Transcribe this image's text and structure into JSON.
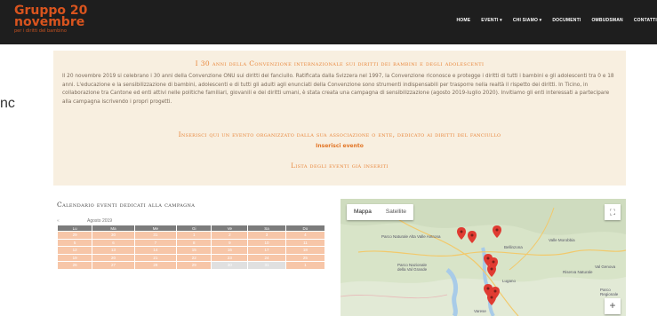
{
  "logo": {
    "line1": "Gruppo 20",
    "line2": "novembre",
    "line3": "per i diritti del bambino"
  },
  "nav": [
    "HOME",
    "EVENTI ▾",
    "CHI SIAMO ▾",
    "DOCUMENTI",
    "OMBUDSMAN",
    "CONTATTI"
  ],
  "stray_text": "nc",
  "banner": {
    "title": "I 30 anni della Convenzione internazionale sui diritti dei bambini e degli adolescenti",
    "body": "Il 20 novembre 2019 si celebrano i 30 anni della Convenzione ONU sui diritti del fanciullo. Ratificata dalla Svizzera nel 1997, la Convenzione riconosce e protegge i diritti di tutti i bambini e gli adolescenti tra 0 e 18 anni. L'educazione e la sensibilizzazione di bambini, adolescenti e di tutti gli adulti agli enunciati della Convenzione sono strumenti indispensabili per trasporre nella realtà il rispetto dei diritti. In Ticino, in collaborazione tra Cantone ed enti attivi nelle politiche familiari, giovanili e dei diritti umani, è stata creata una campagna di sensibilizzazione (agosto 2019-luglio 2020). Invitiamo gli enti interessati a partecipare alla campagna iscrivendo i propri progetti.",
    "register_heading": "Inserisci qui un evento organizzato dalla sua associazione o ente, dedicato ai diritti del fanciullo",
    "register_link": "Inserisci evento",
    "list_link": "Lista degli eventi già inseriti"
  },
  "calendar": {
    "title": "Calendario eventi dedicati alla campagna",
    "prev": "«",
    "month": "Agosto 2019",
    "weekdays": [
      "Lu",
      "Ma",
      "Me",
      "Gi",
      "Ve",
      "Sa",
      "Do"
    ],
    "rows": [
      [
        "29",
        "30",
        "31",
        "1",
        "2",
        "3",
        "4"
      ],
      [
        "5",
        "6",
        "7",
        "8",
        "9",
        "10",
        "11"
      ],
      [
        "12",
        "13",
        "14",
        "15",
        "16",
        "17",
        "18"
      ],
      [
        "19",
        "20",
        "21",
        "22",
        "23",
        "24",
        "25"
      ],
      [
        "26",
        "27",
        "28",
        "29",
        "30",
        "31",
        "1"
      ]
    ]
  },
  "map": {
    "tab_map": "Mappa",
    "tab_satellite": "Satellite",
    "fullscreen": "⛶",
    "zoom_in": "+",
    "labels": [
      "Parco Nazionale della Val Grande",
      "Parco Naturale Alta Valle Antrona",
      "Varese",
      "Lugano",
      "Bellinzona",
      "Valle Morobbia",
      "Riserva Naturale",
      "Val Genova",
      "Parco Regionale"
    ],
    "colors": {
      "water": "#a8cbe8",
      "land": "#d8e4c8",
      "marker": "#e03b32",
      "road": "#f2c96b"
    }
  }
}
